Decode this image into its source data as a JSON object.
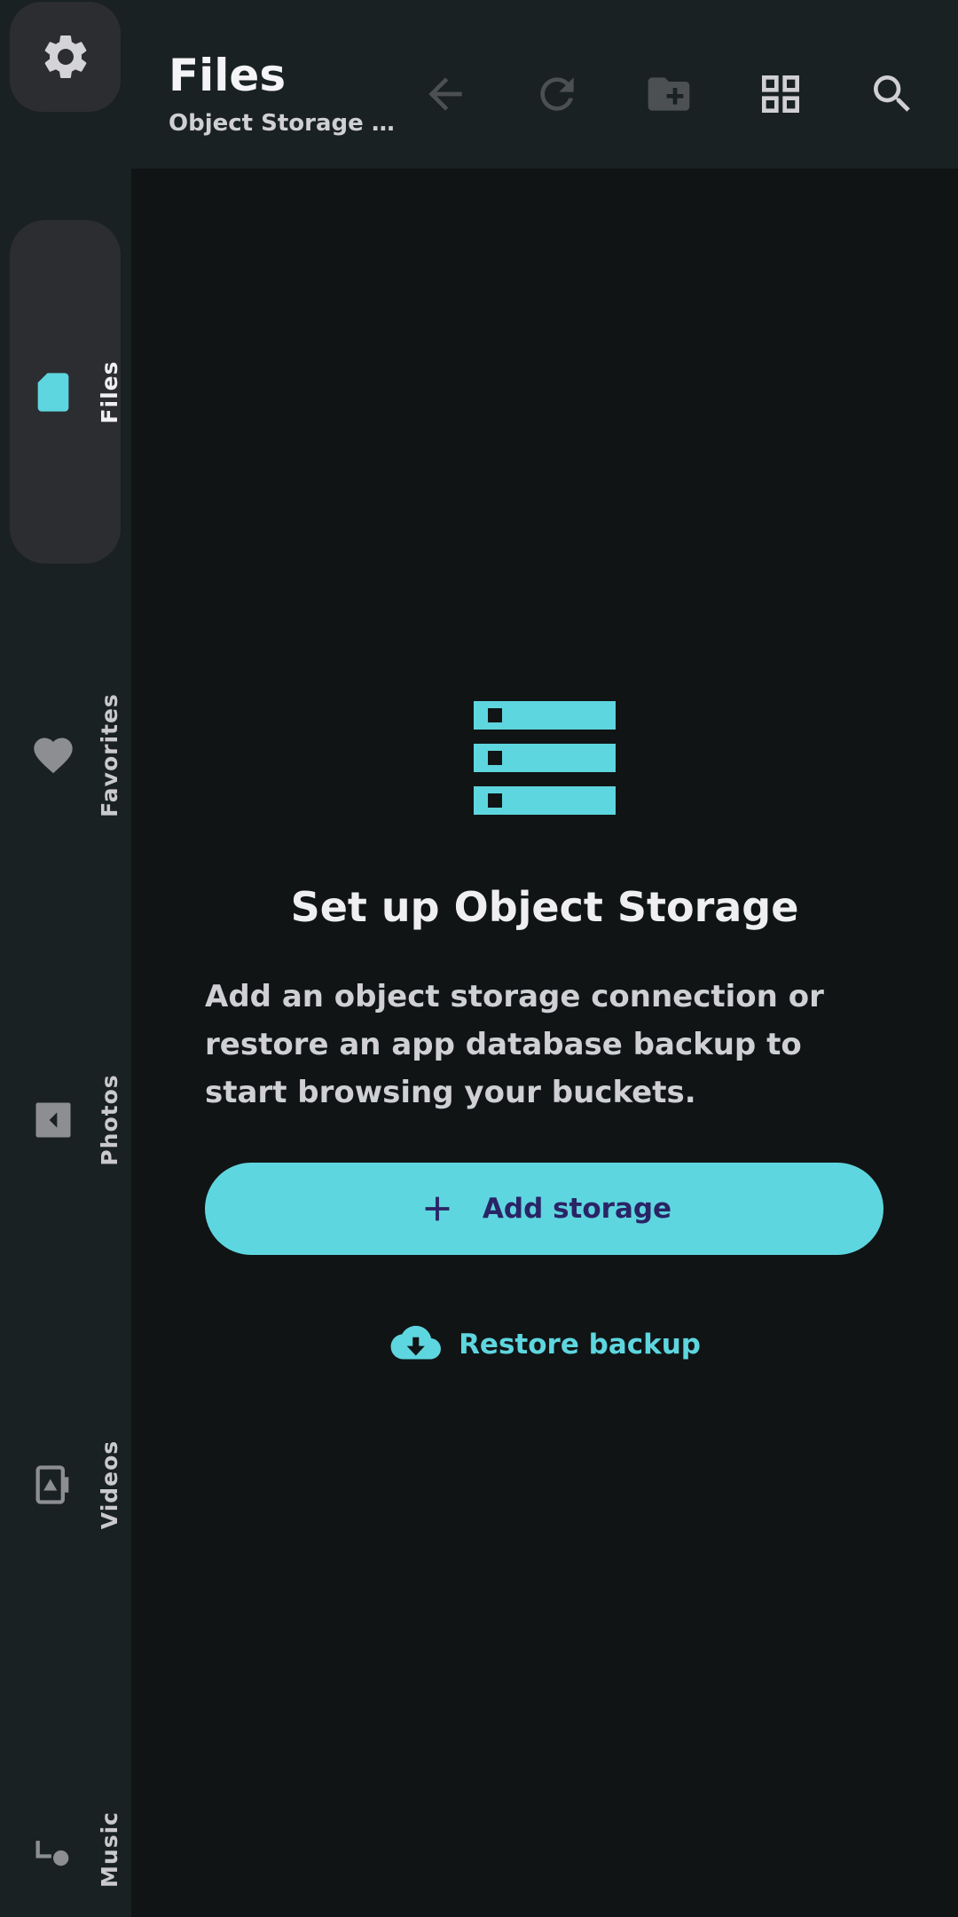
{
  "header": {
    "title": "Files",
    "subtitle": "Object Storage …"
  },
  "toolbar": {
    "back": "arrow-left-icon",
    "refresh": "refresh-icon",
    "new_folder": "folder-plus-icon",
    "grid_view": "grid-view-icon",
    "search": "search-icon"
  },
  "sidebar": {
    "settings_icon": "gear-icon",
    "items": [
      {
        "label": "Files",
        "icon": "sd-card-icon",
        "active": true
      },
      {
        "label": "Favorites",
        "icon": "heart-icon",
        "active": false
      },
      {
        "label": "Photos",
        "icon": "photo-icon",
        "active": false
      },
      {
        "label": "Videos",
        "icon": "video-icon",
        "active": false
      },
      {
        "label": "Music",
        "icon": "music-note-icon",
        "active": false
      }
    ]
  },
  "empty_state": {
    "icon": "server-icon",
    "title": "Set up Object Storage",
    "description": "Add an object storage connection or restore an app database backup to start browsing your buckets.",
    "primary_action": "Add storage",
    "secondary_action": "Restore backup"
  },
  "colors": {
    "accent": "#5ed6df",
    "on_accent": "#2a2466",
    "surface": "#1a2122",
    "background": "#101415",
    "active_pill": "#2c2d31",
    "text_primary": "#f4f4f6",
    "text_secondary": "#cfcfd4"
  }
}
